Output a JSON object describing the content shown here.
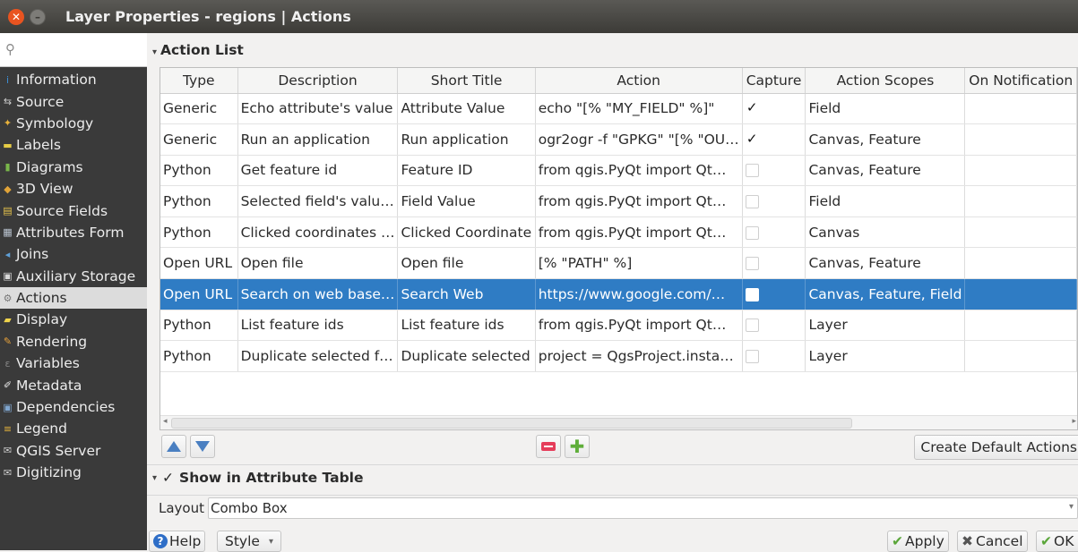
{
  "window": {
    "title": "Layer Properties - regions | Actions",
    "close_icon": "✕",
    "minimize_icon": "–"
  },
  "sidebar": {
    "search_icon": "⚲",
    "items": [
      {
        "label": "Information",
        "icon": "info-icon",
        "glyph": "i",
        "color": "#3d8fd6"
      },
      {
        "label": "Source",
        "icon": "source-icon",
        "glyph": "⇆",
        "color": "#cfcfcf"
      },
      {
        "label": "Symbology",
        "icon": "symbology-icon",
        "glyph": "✦",
        "color": "#e9b23b"
      },
      {
        "label": "Labels",
        "icon": "labels-icon",
        "glyph": "▬",
        "color": "#e6cc45"
      },
      {
        "label": "Diagrams",
        "icon": "diagrams-icon",
        "glyph": "▮",
        "color": "#79b64a"
      },
      {
        "label": "3D View",
        "icon": "3d-view-icon",
        "glyph": "◆",
        "color": "#e0a338"
      },
      {
        "label": "Source Fields",
        "icon": "source-fields-icon",
        "glyph": "▤",
        "color": "#e7c34c"
      },
      {
        "label": "Attributes Form",
        "icon": "attributes-form-icon",
        "glyph": "▦",
        "color": "#b9c3cf"
      },
      {
        "label": "Joins",
        "icon": "joins-icon",
        "glyph": "◂",
        "color": "#5ea0d8"
      },
      {
        "label": "Auxiliary Storage",
        "icon": "auxiliary-storage-icon",
        "glyph": "▣",
        "color": "#d8d8d8"
      },
      {
        "label": "Actions",
        "icon": "actions-icon",
        "glyph": "⚙",
        "color": "#777777"
      },
      {
        "label": "Display",
        "icon": "display-icon",
        "glyph": "▰",
        "color": "#f0d44c"
      },
      {
        "label": "Rendering",
        "icon": "rendering-icon",
        "glyph": "✎",
        "color": "#e8a23a"
      },
      {
        "label": "Variables",
        "icon": "variables-icon",
        "glyph": "ε",
        "color": "#888888"
      },
      {
        "label": "Metadata",
        "icon": "metadata-icon",
        "glyph": "✐",
        "color": "#e7e7e7"
      },
      {
        "label": "Dependencies",
        "icon": "dependencies-icon",
        "glyph": "▣",
        "color": "#7fa6cf"
      },
      {
        "label": "Legend",
        "icon": "legend-icon",
        "glyph": "≡",
        "color": "#e6b43d"
      },
      {
        "label": "QGIS Server",
        "icon": "qgis-server-icon",
        "glyph": "✉",
        "color": "#cfcfcf"
      },
      {
        "label": "Digitizing",
        "icon": "digitizing-icon",
        "glyph": "✉",
        "color": "#cfcfcf"
      }
    ],
    "active_index": 10
  },
  "actions": {
    "section_title": "Action List",
    "columns": [
      "Type",
      "Description",
      "Short Title",
      "Action",
      "Capture",
      "Action Scopes",
      "On Notification"
    ],
    "rows": [
      {
        "type": "Generic",
        "description": "Echo attribute's value",
        "short_title": "Attribute Value",
        "action": "echo \"[% \"MY_FIELD\" %]\"",
        "capture": true,
        "scopes": "Field",
        "notification": ""
      },
      {
        "type": "Generic",
        "description": "Run an application",
        "short_title": "Run application",
        "action": "ogr2ogr -f \"GPKG\" \"[% \"OU…",
        "capture": true,
        "scopes": "Canvas, Feature",
        "notification": ""
      },
      {
        "type": "Python",
        "description": "Get feature id",
        "short_title": "Feature ID",
        "action": "from qgis.PyQt import Qt…",
        "capture": false,
        "scopes": "Canvas, Feature",
        "notification": ""
      },
      {
        "type": "Python",
        "description": "Selected field's valu…",
        "short_title": "Field Value",
        "action": "from qgis.PyQt import Qt…",
        "capture": false,
        "scopes": "Field",
        "notification": ""
      },
      {
        "type": "Python",
        "description": "Clicked coordinates …",
        "short_title": "Clicked Coordinate",
        "action": "from qgis.PyQt import Qt…",
        "capture": false,
        "scopes": "Canvas",
        "notification": ""
      },
      {
        "type": "Open URL",
        "description": "Open file",
        "short_title": "Open file",
        "action": "[% \"PATH\" %]",
        "capture": false,
        "scopes": "Canvas, Feature",
        "notification": ""
      },
      {
        "type": "Open URL",
        "description": "Search on web base…",
        "short_title": "Search Web",
        "action": "https://www.google.com/…",
        "capture": false,
        "scopes": "Canvas, Feature, Field",
        "notification": ""
      },
      {
        "type": "Python",
        "description": "List feature ids",
        "short_title": "List feature ids",
        "action": "from qgis.PyQt import Qt…",
        "capture": false,
        "scopes": "Layer",
        "notification": ""
      },
      {
        "type": "Python",
        "description": "Duplicate selected f…",
        "short_title": "Duplicate selected",
        "action": "project = QgsProject.insta…",
        "capture": false,
        "scopes": "Layer",
        "notification": ""
      }
    ],
    "selected_row": 6,
    "create_default_label": "Create Default Actions"
  },
  "attribute_table": {
    "show_label": "Show in Attribute Table",
    "checked": true,
    "layout_label": "Layout",
    "layout_value": "Combo Box"
  },
  "footer": {
    "help_label": "Help",
    "style_label": "Style",
    "apply_label": "Apply",
    "cancel_label": "Cancel",
    "ok_label": "OK"
  }
}
